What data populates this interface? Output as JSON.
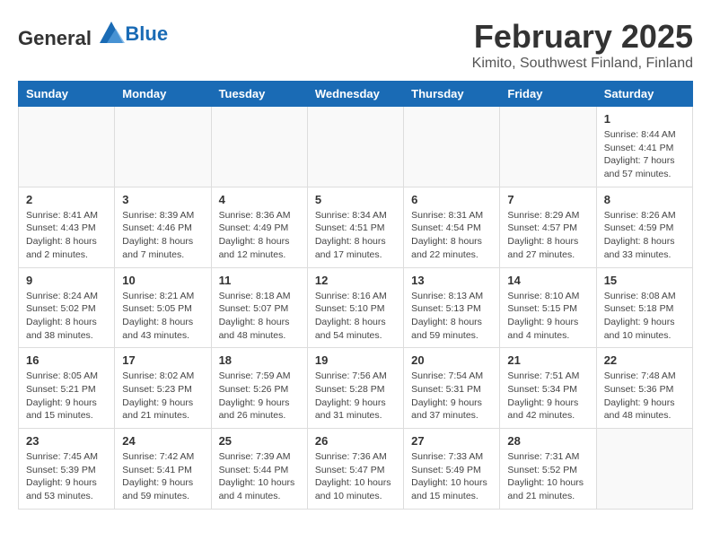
{
  "header": {
    "logo_general": "General",
    "logo_blue": "Blue",
    "month": "February 2025",
    "location": "Kimito, Southwest Finland, Finland"
  },
  "weekdays": [
    "Sunday",
    "Monday",
    "Tuesday",
    "Wednesday",
    "Thursday",
    "Friday",
    "Saturday"
  ],
  "weeks": [
    [
      {
        "day": "",
        "info": ""
      },
      {
        "day": "",
        "info": ""
      },
      {
        "day": "",
        "info": ""
      },
      {
        "day": "",
        "info": ""
      },
      {
        "day": "",
        "info": ""
      },
      {
        "day": "",
        "info": ""
      },
      {
        "day": "1",
        "info": "Sunrise: 8:44 AM\nSunset: 4:41 PM\nDaylight: 7 hours and 57 minutes."
      }
    ],
    [
      {
        "day": "2",
        "info": "Sunrise: 8:41 AM\nSunset: 4:43 PM\nDaylight: 8 hours and 2 minutes."
      },
      {
        "day": "3",
        "info": "Sunrise: 8:39 AM\nSunset: 4:46 PM\nDaylight: 8 hours and 7 minutes."
      },
      {
        "day": "4",
        "info": "Sunrise: 8:36 AM\nSunset: 4:49 PM\nDaylight: 8 hours and 12 minutes."
      },
      {
        "day": "5",
        "info": "Sunrise: 8:34 AM\nSunset: 4:51 PM\nDaylight: 8 hours and 17 minutes."
      },
      {
        "day": "6",
        "info": "Sunrise: 8:31 AM\nSunset: 4:54 PM\nDaylight: 8 hours and 22 minutes."
      },
      {
        "day": "7",
        "info": "Sunrise: 8:29 AM\nSunset: 4:57 PM\nDaylight: 8 hours and 27 minutes."
      },
      {
        "day": "8",
        "info": "Sunrise: 8:26 AM\nSunset: 4:59 PM\nDaylight: 8 hours and 33 minutes."
      }
    ],
    [
      {
        "day": "9",
        "info": "Sunrise: 8:24 AM\nSunset: 5:02 PM\nDaylight: 8 hours and 38 minutes."
      },
      {
        "day": "10",
        "info": "Sunrise: 8:21 AM\nSunset: 5:05 PM\nDaylight: 8 hours and 43 minutes."
      },
      {
        "day": "11",
        "info": "Sunrise: 8:18 AM\nSunset: 5:07 PM\nDaylight: 8 hours and 48 minutes."
      },
      {
        "day": "12",
        "info": "Sunrise: 8:16 AM\nSunset: 5:10 PM\nDaylight: 8 hours and 54 minutes."
      },
      {
        "day": "13",
        "info": "Sunrise: 8:13 AM\nSunset: 5:13 PM\nDaylight: 8 hours and 59 minutes."
      },
      {
        "day": "14",
        "info": "Sunrise: 8:10 AM\nSunset: 5:15 PM\nDaylight: 9 hours and 4 minutes."
      },
      {
        "day": "15",
        "info": "Sunrise: 8:08 AM\nSunset: 5:18 PM\nDaylight: 9 hours and 10 minutes."
      }
    ],
    [
      {
        "day": "16",
        "info": "Sunrise: 8:05 AM\nSunset: 5:21 PM\nDaylight: 9 hours and 15 minutes."
      },
      {
        "day": "17",
        "info": "Sunrise: 8:02 AM\nSunset: 5:23 PM\nDaylight: 9 hours and 21 minutes."
      },
      {
        "day": "18",
        "info": "Sunrise: 7:59 AM\nSunset: 5:26 PM\nDaylight: 9 hours and 26 minutes."
      },
      {
        "day": "19",
        "info": "Sunrise: 7:56 AM\nSunset: 5:28 PM\nDaylight: 9 hours and 31 minutes."
      },
      {
        "day": "20",
        "info": "Sunrise: 7:54 AM\nSunset: 5:31 PM\nDaylight: 9 hours and 37 minutes."
      },
      {
        "day": "21",
        "info": "Sunrise: 7:51 AM\nSunset: 5:34 PM\nDaylight: 9 hours and 42 minutes."
      },
      {
        "day": "22",
        "info": "Sunrise: 7:48 AM\nSunset: 5:36 PM\nDaylight: 9 hours and 48 minutes."
      }
    ],
    [
      {
        "day": "23",
        "info": "Sunrise: 7:45 AM\nSunset: 5:39 PM\nDaylight: 9 hours and 53 minutes."
      },
      {
        "day": "24",
        "info": "Sunrise: 7:42 AM\nSunset: 5:41 PM\nDaylight: 9 hours and 59 minutes."
      },
      {
        "day": "25",
        "info": "Sunrise: 7:39 AM\nSunset: 5:44 PM\nDaylight: 10 hours and 4 minutes."
      },
      {
        "day": "26",
        "info": "Sunrise: 7:36 AM\nSunset: 5:47 PM\nDaylight: 10 hours and 10 minutes."
      },
      {
        "day": "27",
        "info": "Sunrise: 7:33 AM\nSunset: 5:49 PM\nDaylight: 10 hours and 15 minutes."
      },
      {
        "day": "28",
        "info": "Sunrise: 7:31 AM\nSunset: 5:52 PM\nDaylight: 10 hours and 21 minutes."
      },
      {
        "day": "",
        "info": ""
      }
    ]
  ]
}
